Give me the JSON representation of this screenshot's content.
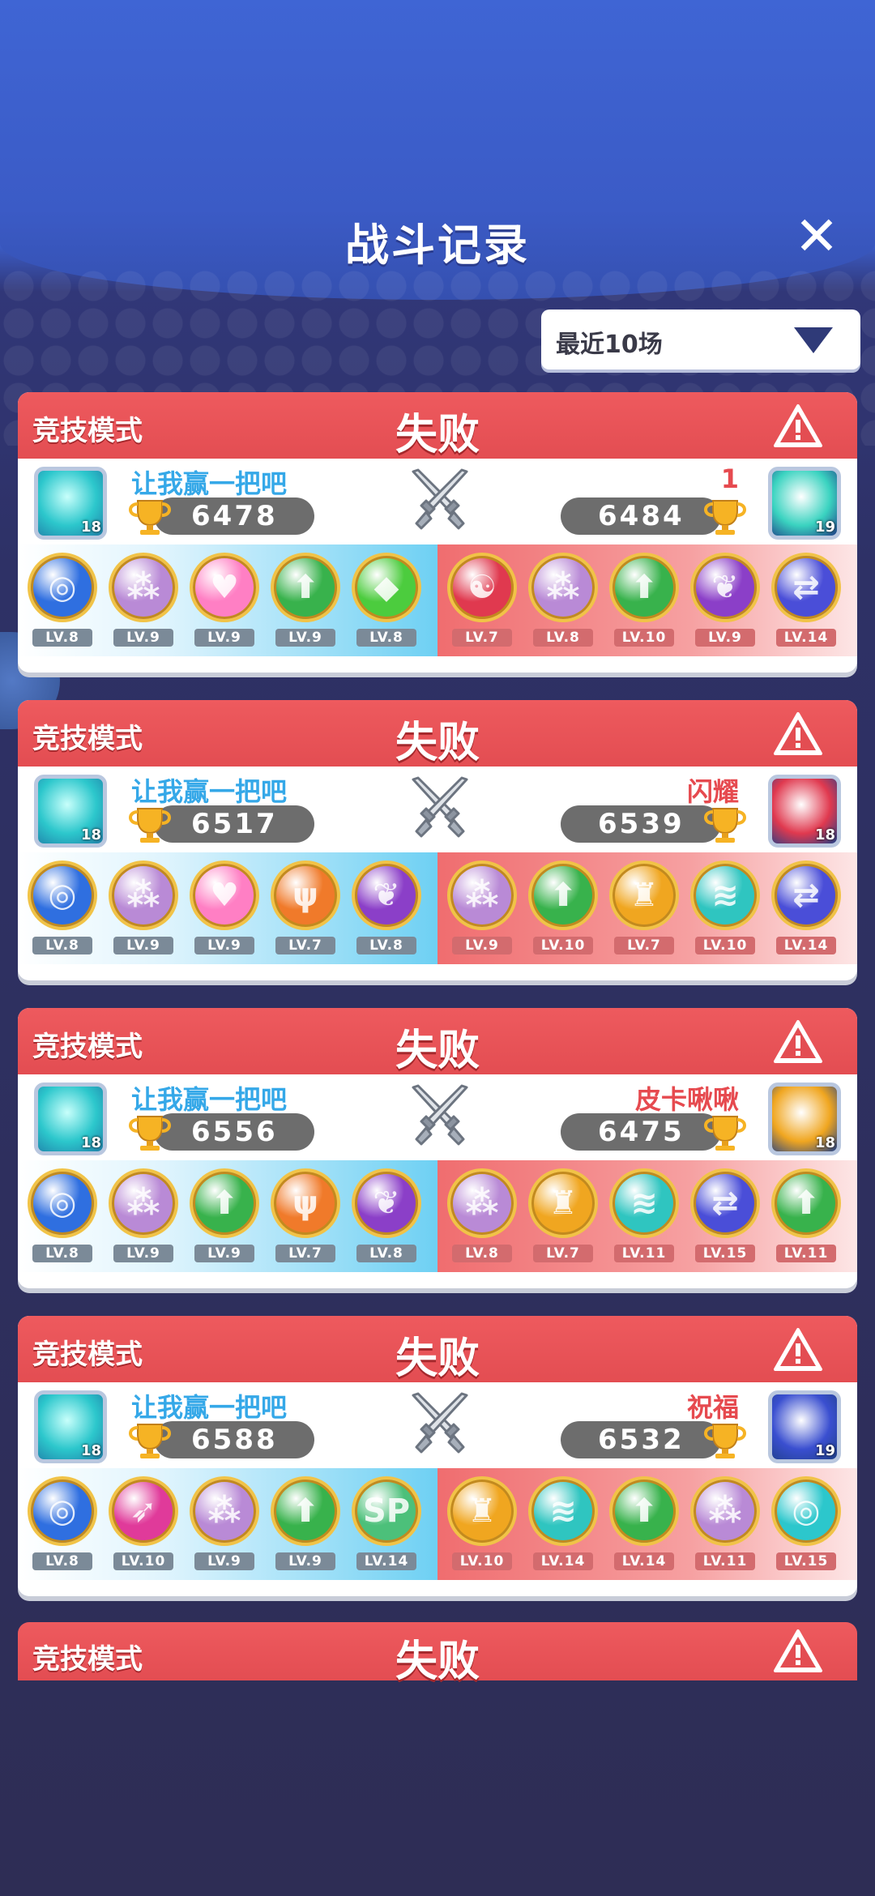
{
  "header": {
    "title": "战斗记录",
    "close_icon": "close-icon"
  },
  "filter": {
    "label": "最近10场",
    "icon": "chevron-down-icon"
  },
  "matches": [
    {
      "mode": "竞技模式",
      "result": "失败",
      "left": {
        "name": "让我赢一把吧",
        "score": "6478",
        "avatar_level": "18",
        "avatar_color": "#2cc7cc"
      },
      "right": {
        "name": "1",
        "score": "6484",
        "avatar_level": "19",
        "avatar_color": "#3ad3c0"
      },
      "left_gems": [
        {
          "lv": "LV.8",
          "color": "#2f6fe0",
          "icon": "swirl-gem-icon"
        },
        {
          "lv": "LV.9",
          "color": "#b98ad6",
          "icon": "figures-gem-icon"
        },
        {
          "lv": "LV.9",
          "color": "#ff7fc4",
          "icon": "heart-gem-icon"
        },
        {
          "lv": "LV.9",
          "color": "#38b24c",
          "icon": "arrow-up-gem-icon"
        },
        {
          "lv": "LV.8",
          "color": "#4ccc3e",
          "icon": "diamond-gem-icon"
        }
      ],
      "right_gems": [
        {
          "lv": "LV.7",
          "color": "#e0394f",
          "icon": "yin-yang-gem-icon"
        },
        {
          "lv": "LV.8",
          "color": "#b98ad6",
          "icon": "figures-gem-icon"
        },
        {
          "lv": "LV.10",
          "color": "#38b24c",
          "icon": "arrow-up-gem-icon"
        },
        {
          "lv": "LV.9",
          "color": "#8b3fc8",
          "icon": "leaf-gem-icon"
        },
        {
          "lv": "LV.14",
          "color": "#4a4ed8",
          "icon": "swap-gem-icon"
        }
      ]
    },
    {
      "mode": "竞技模式",
      "result": "失败",
      "left": {
        "name": "让我赢一把吧",
        "score": "6517",
        "avatar_level": "18",
        "avatar_color": "#2cc7cc"
      },
      "right": {
        "name": "闪耀",
        "score": "6539",
        "avatar_level": "18",
        "avatar_color": "#e0394f"
      },
      "left_gems": [
        {
          "lv": "LV.8",
          "color": "#2f6fe0",
          "icon": "swirl-gem-icon"
        },
        {
          "lv": "LV.9",
          "color": "#b98ad6",
          "icon": "figures-gem-icon"
        },
        {
          "lv": "LV.9",
          "color": "#ff7fc4",
          "icon": "heart-gem-icon"
        },
        {
          "lv": "LV.7",
          "color": "#f07a2a",
          "icon": "wings-gem-icon"
        },
        {
          "lv": "LV.8",
          "color": "#8b3fc8",
          "icon": "leaf-gem-icon"
        }
      ],
      "right_gems": [
        {
          "lv": "LV.9",
          "color": "#b98ad6",
          "icon": "figures-gem-icon"
        },
        {
          "lv": "LV.10",
          "color": "#38b24c",
          "icon": "arrow-up-gem-icon"
        },
        {
          "lv": "LV.7",
          "color": "#f0a620",
          "icon": "helmet-gem-icon"
        },
        {
          "lv": "LV.10",
          "color": "#2fc5c0",
          "icon": "tornado-gem-icon"
        },
        {
          "lv": "LV.14",
          "color": "#4a4ed8",
          "icon": "swap-gem-icon"
        }
      ]
    },
    {
      "mode": "竞技模式",
      "result": "失败",
      "left": {
        "name": "让我赢一把吧",
        "score": "6556",
        "avatar_level": "18",
        "avatar_color": "#2cc7cc"
      },
      "right": {
        "name": "皮卡啾啾",
        "score": "6475",
        "avatar_level": "18",
        "avatar_color": "#f0a620"
      },
      "left_gems": [
        {
          "lv": "LV.8",
          "color": "#2f6fe0",
          "icon": "swirl-gem-icon"
        },
        {
          "lv": "LV.9",
          "color": "#b98ad6",
          "icon": "figures-gem-icon"
        },
        {
          "lv": "LV.9",
          "color": "#38b24c",
          "icon": "arrow-up-gem-icon"
        },
        {
          "lv": "LV.7",
          "color": "#f07a2a",
          "icon": "wings-gem-icon"
        },
        {
          "lv": "LV.8",
          "color": "#8b3fc8",
          "icon": "leaf-gem-icon"
        }
      ],
      "right_gems": [
        {
          "lv": "LV.8",
          "color": "#b98ad6",
          "icon": "figures-gem-icon"
        },
        {
          "lv": "LV.7",
          "color": "#f0a620",
          "icon": "helmet-gem-icon"
        },
        {
          "lv": "LV.11",
          "color": "#2fc5c0",
          "icon": "tornado-gem-icon"
        },
        {
          "lv": "LV.15",
          "color": "#4a4ed8",
          "icon": "swap-gem-icon"
        },
        {
          "lv": "LV.11",
          "color": "#38b24c",
          "icon": "arrow-up-gem-icon"
        }
      ]
    },
    {
      "mode": "竞技模式",
      "result": "失败",
      "left": {
        "name": "让我赢一把吧",
        "score": "6588",
        "avatar_level": "18",
        "avatar_color": "#2cc7cc"
      },
      "right": {
        "name": "祝福",
        "score": "6532",
        "avatar_level": "19",
        "avatar_color": "#3a4fd0"
      },
      "left_gems": [
        {
          "lv": "LV.8",
          "color": "#2f6fe0",
          "icon": "swirl-gem-icon"
        },
        {
          "lv": "LV.10",
          "color": "#e03a9a",
          "icon": "feather-gem-icon"
        },
        {
          "lv": "LV.9",
          "color": "#b98ad6",
          "icon": "figures-gem-icon"
        },
        {
          "lv": "LV.9",
          "color": "#38b24c",
          "icon": "arrow-up-gem-icon"
        },
        {
          "lv": "LV.14",
          "color": "#4cc07a",
          "icon": "sp-gem-icon"
        }
      ],
      "right_gems": [
        {
          "lv": "LV.10",
          "color": "#f0a620",
          "icon": "helmet-gem-icon"
        },
        {
          "lv": "LV.14",
          "color": "#2fc5c0",
          "icon": "tornado-gem-icon"
        },
        {
          "lv": "LV.14",
          "color": "#38b24c",
          "icon": "arrow-up-gem-icon"
        },
        {
          "lv": "LV.11",
          "color": "#b98ad6",
          "icon": "figures-gem-icon"
        },
        {
          "lv": "LV.15",
          "color": "#2cc7cc",
          "icon": "swirl-gem-icon"
        }
      ]
    }
  ],
  "partial_card": {
    "mode": "竞技模式",
    "result": "失败"
  }
}
